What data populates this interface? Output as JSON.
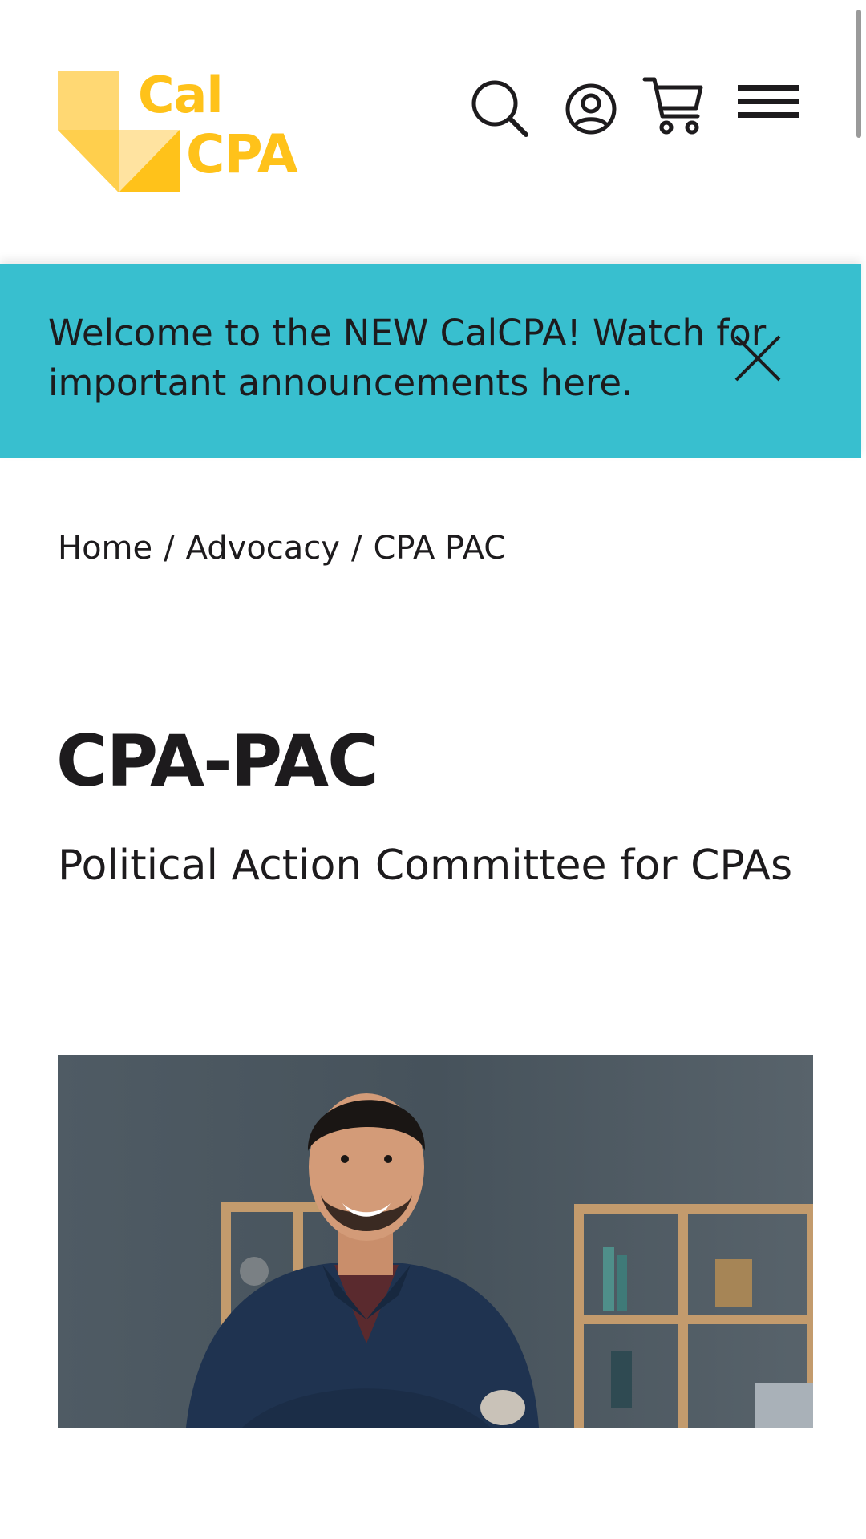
{
  "header": {
    "logo": {
      "line1": "Cal",
      "line2": "CPA",
      "color": "#ffc21a"
    },
    "icons": [
      "search-icon",
      "account-icon",
      "cart-icon",
      "menu-icon"
    ]
  },
  "banner": {
    "text": "Welcome to the NEW CalCPA! Watch for important announcements here.",
    "background": "#38bfcf",
    "close_icon": "close-icon"
  },
  "breadcrumb": {
    "items": [
      "Home",
      "Advocacy",
      "CPA PAC"
    ],
    "separator": "/"
  },
  "page": {
    "title": "CPA-PAC",
    "subtitle": "Political Action Committee for CPAs"
  },
  "hero": {
    "description_icon": "photo-smiling-man-office"
  }
}
